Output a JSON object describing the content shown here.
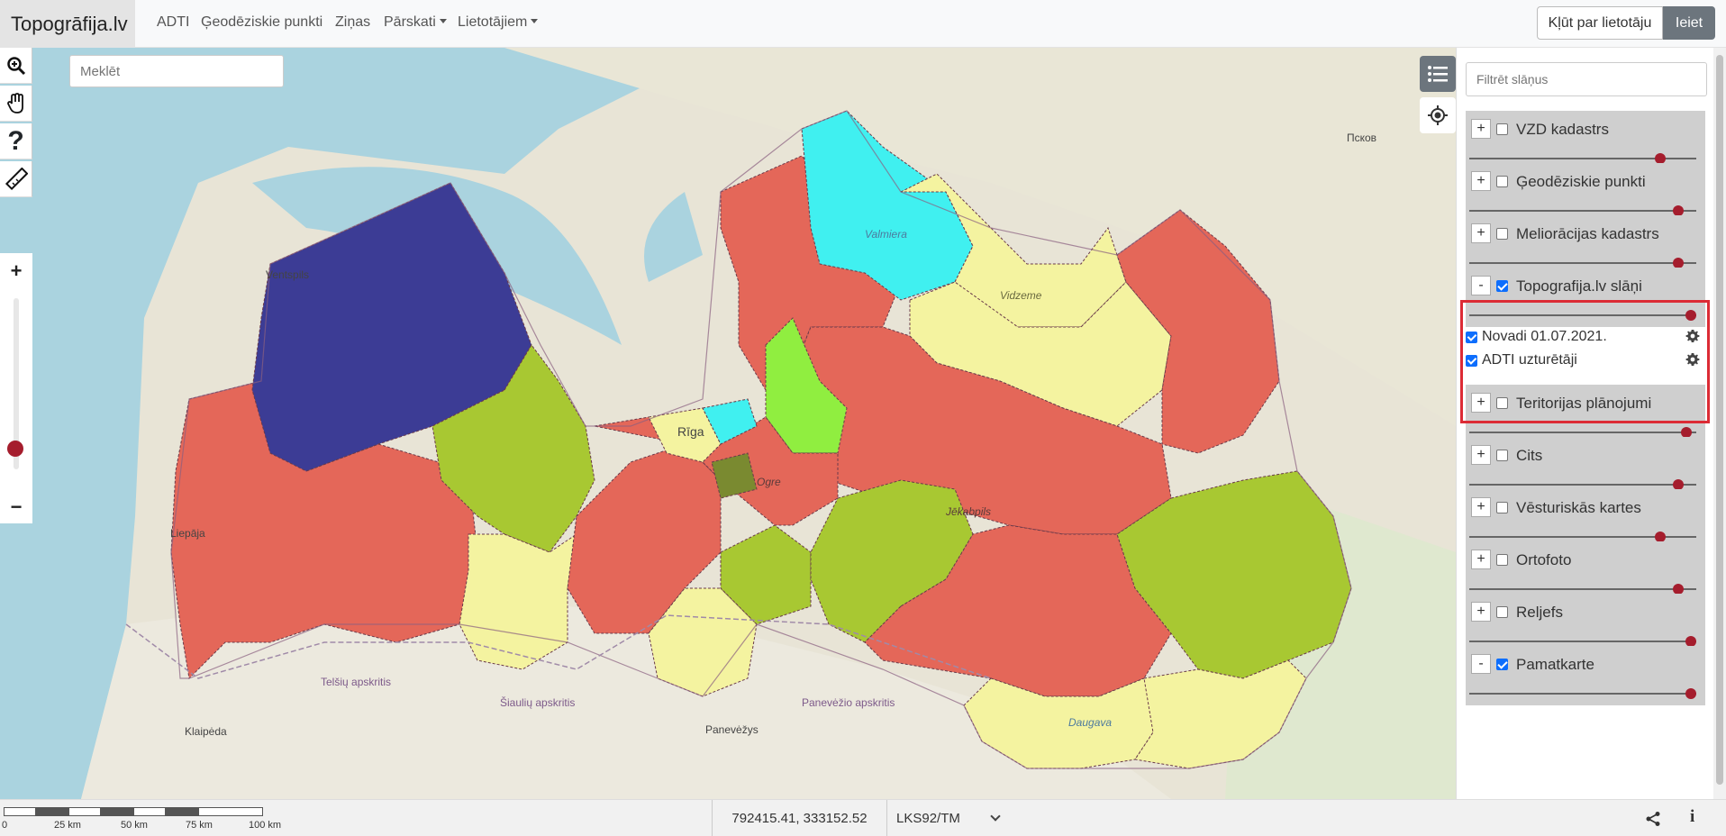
{
  "app": {
    "title": "Topogrāfija.lv"
  },
  "nav": {
    "items": [
      {
        "label": "ADTI"
      },
      {
        "label": "Ģeodēziskie punkti"
      },
      {
        "label": "Ziņas"
      },
      {
        "label": "Pārskati"
      },
      {
        "label": "Lietotājiem"
      }
    ],
    "register_label": "Kļūt par lietotāju",
    "login_label": "Ieiet"
  },
  "map": {
    "search_placeholder": "Meklēt",
    "zoom_level_fraction": 0.12,
    "labels": [
      {
        "text": "Valmiera"
      },
      {
        "text": "Rīga"
      },
      {
        "text": "Ogre"
      },
      {
        "text": "Jēkabpils"
      },
      {
        "text": "Vidzeme"
      },
      {
        "text": "Liepāja"
      },
      {
        "text": "Ventspils"
      },
      {
        "text": "Klaipėda"
      },
      {
        "text": "Panevėžys"
      },
      {
        "text": "Šiaulių apskritis"
      },
      {
        "text": "Panevėžio apskritis"
      },
      {
        "text": "Telšių apskritis"
      },
      {
        "text": "Daugava"
      },
      {
        "text": "Псков"
      }
    ]
  },
  "sidebar": {
    "filter_placeholder": "Filtrēt slāņus",
    "layers": [
      {
        "name": "VZD kadastrs",
        "toggle": "+",
        "checked": false,
        "opacity": 0.86
      },
      {
        "name": "Ģeodēziskie punkti",
        "toggle": "+",
        "checked": false,
        "opacity": 0.94
      },
      {
        "name": "Meliorācijas kadastrs",
        "toggle": "+",
        "checked": false,
        "opacity": 0.94
      },
      {
        "name": "Topografija.lv slāņi",
        "toggle": "-",
        "checked": true,
        "opacity": 1.0,
        "sublayers": [
          {
            "name": "Novadi 01.07.2021.",
            "checked": true
          },
          {
            "name": "ADTI uzturētāji",
            "checked": true
          }
        ]
      },
      {
        "name": "Teritorijas plānojumi",
        "toggle": "+",
        "checked": false,
        "opacity": 0.98
      },
      {
        "name": "Cits",
        "toggle": "+",
        "checked": false,
        "opacity": 0.94
      },
      {
        "name": "Vēsturiskās kartes",
        "toggle": "+",
        "checked": false,
        "opacity": 0.86
      },
      {
        "name": "Ortofoto",
        "toggle": "+",
        "checked": false,
        "opacity": 0.94
      },
      {
        "name": "Reljefs",
        "toggle": "+",
        "checked": false,
        "opacity": 1.0
      },
      {
        "name": "Pamatkarte",
        "toggle": "-",
        "checked": true,
        "opacity": 1.0
      }
    ]
  },
  "footer": {
    "scale_labels": [
      "0",
      "25 km",
      "50 km",
      "75 km",
      "100 km"
    ],
    "coordinates": "792415.41, 333152.52",
    "crs": "LKS92/TM"
  },
  "colors": {
    "region_red": "#e46759",
    "region_green": "#a8c832",
    "region_yellow": "#f4f3a0",
    "region_navy": "#3c3c95",
    "region_cyan": "#40f0f0",
    "region_lime": "#90ee40",
    "highlight": "#dc2b35",
    "accent": "#a51d2d"
  }
}
